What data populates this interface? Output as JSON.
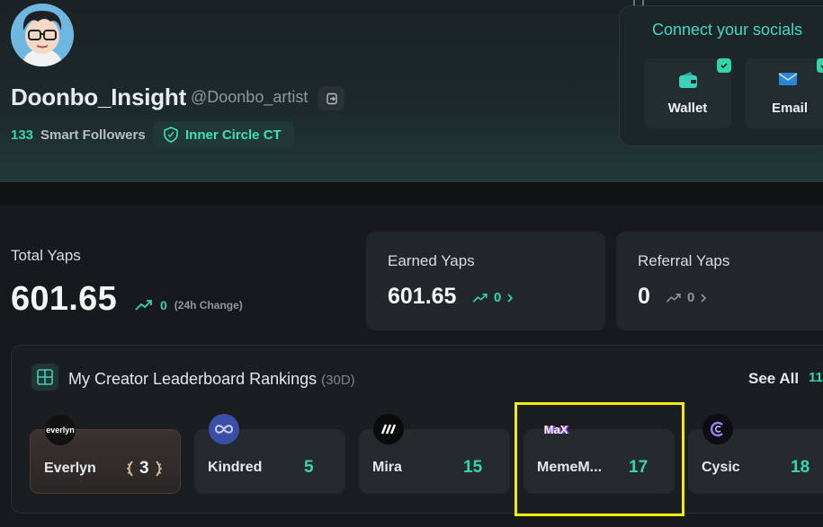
{
  "profile": {
    "username": "Doonbo_Insight",
    "handle": "@Doonbo_artist",
    "smart_followers_count": "133",
    "smart_followers_label": "Smart Followers",
    "badge_label": "Inner Circle CT"
  },
  "socials": {
    "title": "Connect your socials",
    "items": [
      {
        "label": "Wallet",
        "icon": "wallet-icon"
      },
      {
        "label": "Email",
        "icon": "mail-icon"
      }
    ]
  },
  "stats": {
    "total_label": "Total Yaps",
    "total_value": "601.65",
    "total_change": "0",
    "total_change_note": "(24h Change)",
    "earned_label": "Earned Yaps",
    "earned_value": "601.65",
    "earned_change": "0",
    "referral_label": "Referral Yaps",
    "referral_value": "0",
    "referral_change": "0"
  },
  "leaderboard": {
    "title": "My Creator Leaderboard Rankings",
    "period": "(30D)",
    "see_all": "See All",
    "see_all_count": "11",
    "items": [
      {
        "name": "Everlyn",
        "rank": "3",
        "logo_text": "everlyn"
      },
      {
        "name": "Kindred",
        "rank": "5",
        "logo_text": ""
      },
      {
        "name": "Mira",
        "rank": "15",
        "logo_text": ""
      },
      {
        "name": "MemeM...",
        "rank": "17",
        "logo_text": "MaX"
      },
      {
        "name": "Cysic",
        "rank": "18",
        "logo_text": ""
      }
    ]
  },
  "colors": {
    "accent": "#35d5b0",
    "highlight": "#f5e90e"
  }
}
